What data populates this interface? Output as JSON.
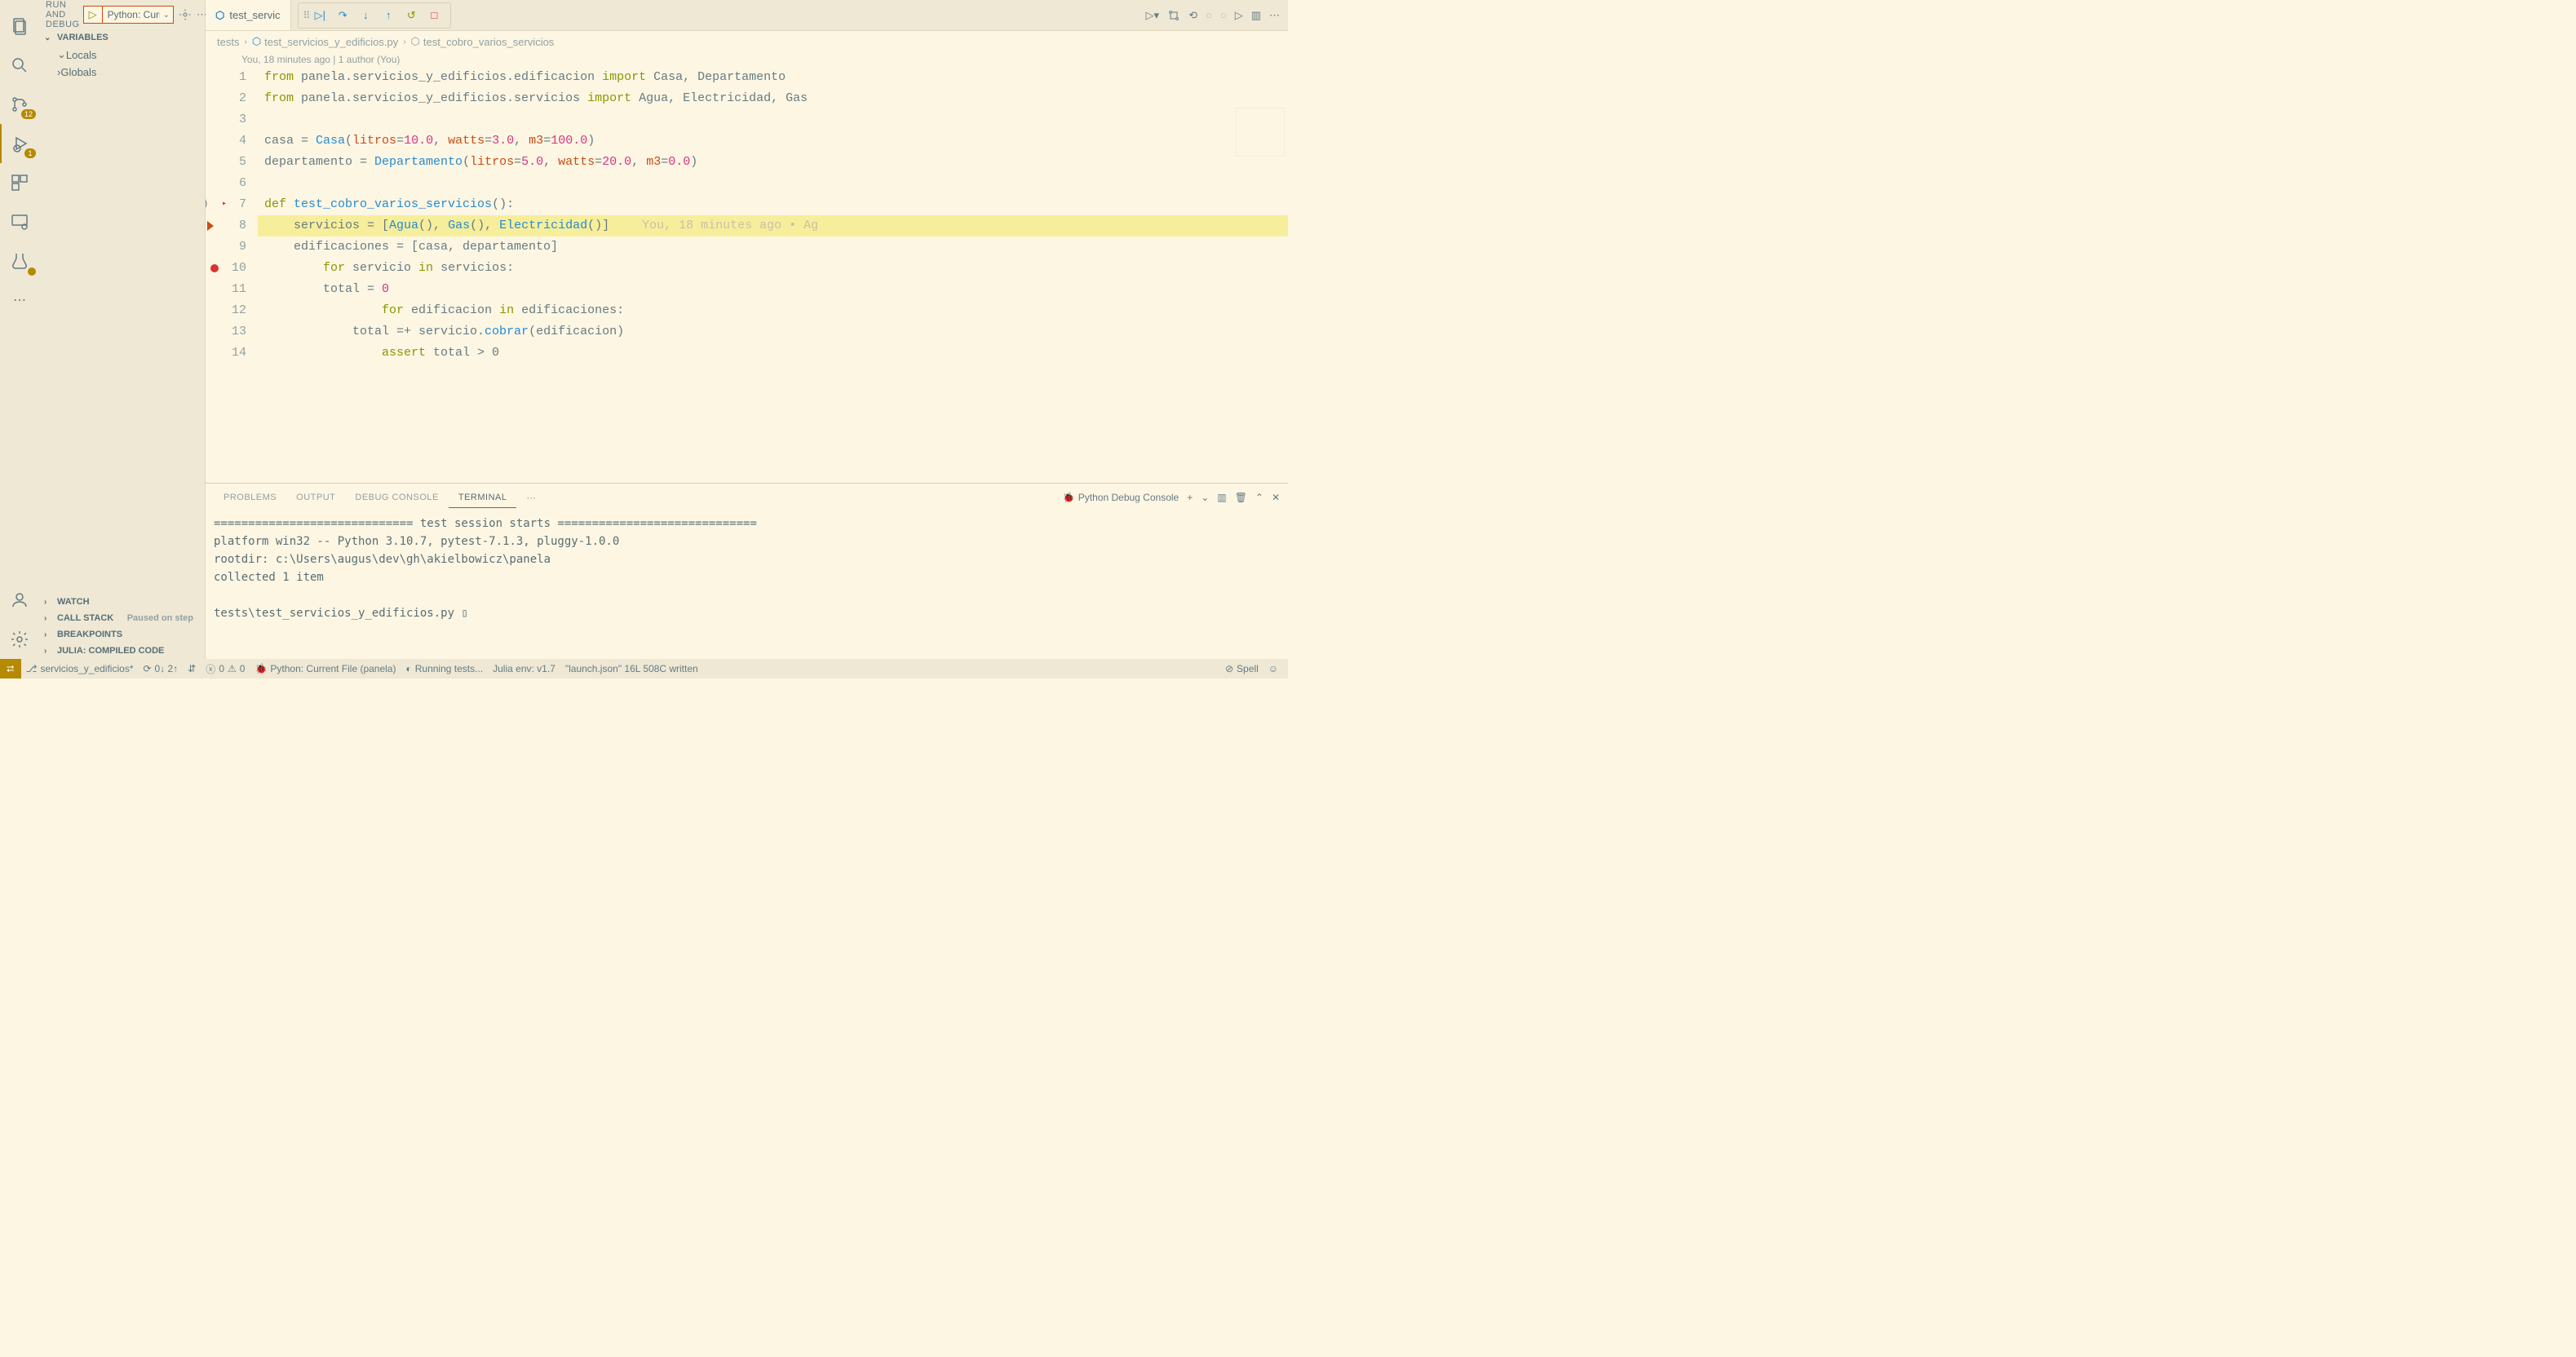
{
  "activity_bar": {
    "scm_badge": "12",
    "debug_badge": "1"
  },
  "sidebar": {
    "title": "RUN AND DEBUG",
    "run_config": "Python: Current F",
    "sections": {
      "variables": "VARIABLES",
      "locals": "Locals",
      "globals": "Globals",
      "watch": "WATCH",
      "call_stack": "CALL STACK",
      "call_stack_status": "Paused on step",
      "breakpoints": "BREAKPOINTS",
      "julia": "JULIA: COMPILED CODE"
    }
  },
  "tab": {
    "filename": "test_servic"
  },
  "breadcrumb": {
    "folder": "tests",
    "file": "test_servicios_y_edificios.py",
    "symbol": "test_cobro_varios_servicios"
  },
  "codelens": "You, 18 minutes ago | 1 author (You)",
  "code": {
    "line1_a": "from",
    "line1_b": " panela.servicios_y_edificios.edificacion ",
    "line1_c": "import",
    "line1_d": " Casa, Departamento",
    "line2_a": "from",
    "line2_b": " panela.servicios_y_edificios.servicios ",
    "line2_c": "import",
    "line2_d": " Agua, Electricidad, Gas",
    "line4": "casa = Casa(litros=10.0, watts=3.0, m3=100.0)",
    "line5": "departamento = Departamento(litros=5.0, watts=20.0, m3=0.0)",
    "line7_a": "def",
    "line7_b": " test_cobro_varios_servicios",
    "line7_c": "():",
    "line8": "    servicios = [Agua(), Gas(), Electricidad()]",
    "line8_blame": "You, 18 minutes ago • Ag",
    "line9": "    edificaciones = [casa, departamento]",
    "line10_a": "    for",
    "line10_b": " servicio ",
    "line10_c": "in",
    "line10_d": " servicios:",
    "line11": "        total = 0",
    "line12_a": "        for",
    "line12_b": " edificacion ",
    "line12_c": "in",
    "line12_d": " edificaciones:",
    "line13": "            total =+ servicio.cobrar(edificacion)",
    "line14_a": "        assert",
    "line14_b": " total > 0"
  },
  "line_numbers": [
    "1",
    "2",
    "3",
    "4",
    "5",
    "6",
    "7",
    "8",
    "9",
    "10",
    "11",
    "12",
    "13",
    "14"
  ],
  "panel": {
    "tabs": {
      "problems": "PROBLEMS",
      "output": "OUTPUT",
      "debug_console": "DEBUG CONSOLE",
      "terminal": "TERMINAL"
    },
    "terminal_name": "Python Debug Console"
  },
  "terminal_output": "============================= test session starts =============================\nplatform win32 -- Python 3.10.7, pytest-7.1.3, pluggy-1.0.0\nrootdir: c:\\Users\\augus\\dev\\gh\\akielbowicz\\panela\ncollected 1 item\n\ntests\\test_servicios_y_edificios.py ▯",
  "status": {
    "branch": "servicios_y_edificios*",
    "sync": "0↓ 2↑",
    "errors": "0",
    "warnings": "0",
    "python": "Python: Current File (panela)",
    "running": "Running tests...",
    "julia": "Julia env: v1.7",
    "launch": "\"launch.json\" 16L 508C written",
    "spell": "Spell"
  }
}
